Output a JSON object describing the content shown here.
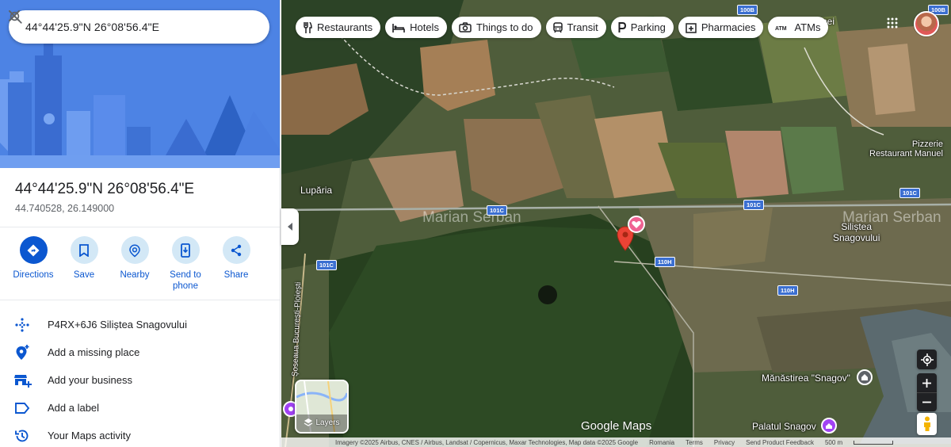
{
  "search": {
    "query": "44°44'25.9\"N 26°08'56.4\"E"
  },
  "place": {
    "title": "44°44'25.9\"N 26°08'56.4\"E",
    "decimal": "44.740528, 26.149000"
  },
  "actions": [
    {
      "label": "Directions",
      "icon": "directions-icon"
    },
    {
      "label": "Save",
      "icon": "bookmark-icon"
    },
    {
      "label": "Nearby",
      "icon": "nearby-icon"
    },
    {
      "label": "Send to\nphone",
      "icon": "phone-icon"
    },
    {
      "label": "Share",
      "icon": "share-icon"
    }
  ],
  "info": [
    {
      "text": "P4RX+6J6 Siliștea Snagovului",
      "icon": "plus-code-icon"
    },
    {
      "text": "Add a missing place",
      "icon": "add-place-icon"
    },
    {
      "text": "Add your business",
      "icon": "add-business-icon"
    },
    {
      "text": "Add a label",
      "icon": "label-icon"
    },
    {
      "text": "Your Maps activity",
      "icon": "history-icon"
    }
  ],
  "chips": [
    {
      "label": "Restaurants",
      "icon": "restaurant-icon"
    },
    {
      "label": "Hotels",
      "icon": "hotel-icon"
    },
    {
      "label": "Things to do",
      "icon": "camera-icon"
    },
    {
      "label": "Transit",
      "icon": "transit-icon"
    },
    {
      "label": "Parking",
      "icon": "parking-icon"
    },
    {
      "label": "Pharmacies",
      "icon": "pharmacy-icon"
    },
    {
      "label": "ATMs",
      "icon": "atm-icon"
    }
  ],
  "map": {
    "labels": {
      "lupsaria": "Lupăria",
      "silistea": "Siliștea\nSnagovului",
      "pizzerie": "Pizzerie\nRestaurant Manuel",
      "manastirea": "Mănăstirea \"Snagov\"",
      "palatul": "Palatul Snagov",
      "soseaua": "Șoseaua București-Ploiești",
      "mnei": "mnei"
    },
    "watermark": "Marian Serban",
    "shields": {
      "s1": "101C",
      "s2": "101C",
      "s3": "101C",
      "s4": "101C",
      "s5": "110H",
      "s6": "110H",
      "s7": "100B",
      "s8": "100B"
    },
    "layers_label": "Layers",
    "logo": "Google Maps",
    "footer": {
      "imagery": "Imagery ©2025 Airbus, CNES / Airbus, Landsat / Copernicus, Maxar Technologies, Map data ©2025 Google",
      "region": "Romania",
      "terms": "Terms",
      "privacy": "Privacy",
      "feedback": "Send Product Feedback",
      "scale": "500 m"
    },
    "colors": {
      "pin": "#ea4335",
      "accent": "#0b57d0"
    }
  }
}
